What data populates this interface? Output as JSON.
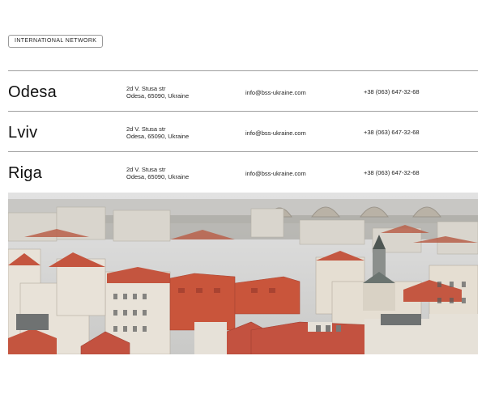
{
  "badge": {
    "label": "INTERNATIONAL NETWORK"
  },
  "offices": [
    {
      "city": "Odesa",
      "address_line1": "2d V. Stusa str",
      "address_line2": "Odesa, 65090, Ukraine",
      "email": "info@bss-ukraine.com",
      "phone": "+38 (063) 647-32-68"
    },
    {
      "city": "Lviv",
      "address_line1": "2d V. Stusa str",
      "address_line2": "Odesa, 65090, Ukraine",
      "email": "info@bss-ukraine.com",
      "phone": "+38 (063) 647-32-68"
    },
    {
      "city": "Riga",
      "address_line1": "2d V. Stusa str",
      "address_line2": "Odesa, 65090, Ukraine",
      "email": "info@bss-ukraine.com",
      "phone": "+38 (063) 647-32-68"
    }
  ],
  "colors": {
    "divider": "#9f9f9f",
    "roof": "#c4553f",
    "facade": "#e8e2d8",
    "sky": "#d8d8d8"
  }
}
